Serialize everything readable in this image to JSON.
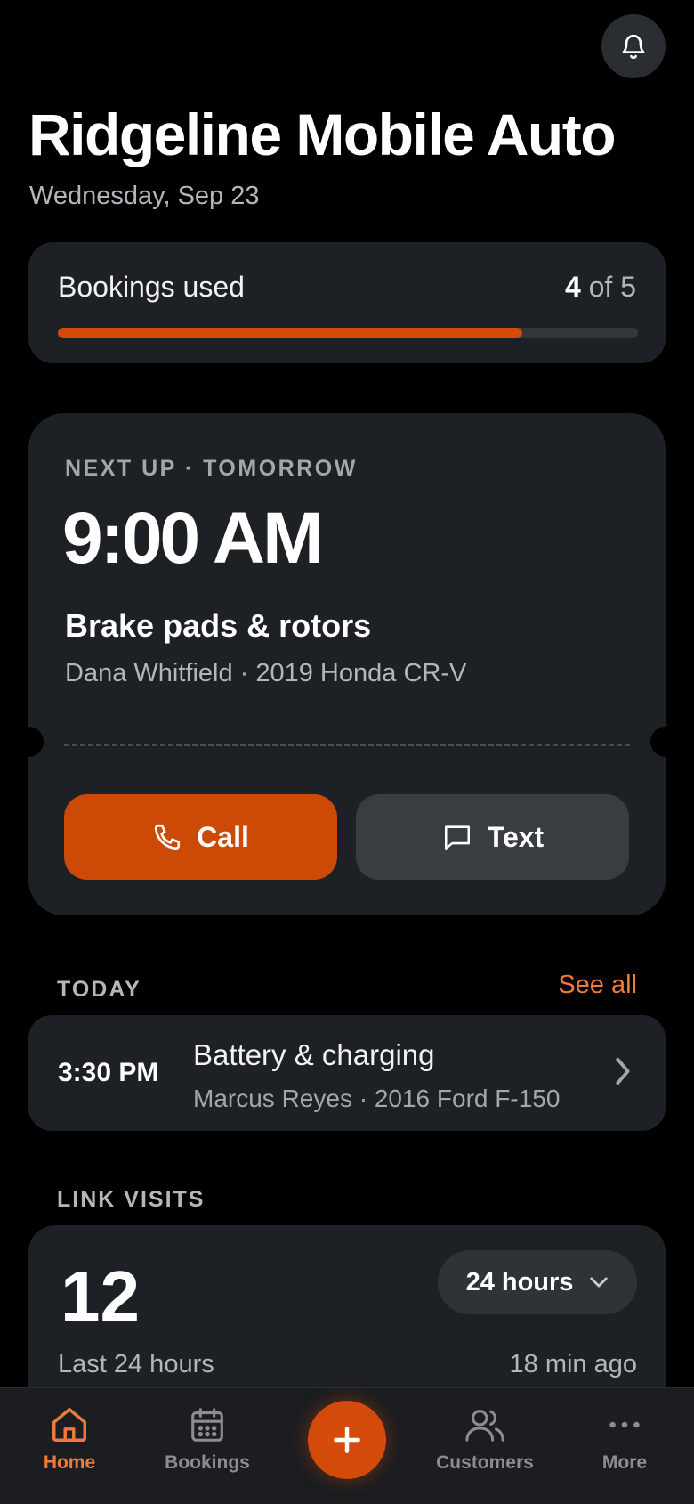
{
  "header": {
    "title": "Ridgeline Mobile Auto",
    "date": "Wednesday, Sep 23"
  },
  "usage": {
    "label": "Bookings used",
    "used": "4",
    "of_total": "of 5",
    "fill_fraction": 0.8
  },
  "next_up": {
    "label": "NEXT UP · TOMORROW",
    "time": "9:00 AM",
    "service": "Brake pads & rotors",
    "customer": "Dana Whitfield · 2019 Honda CR-V",
    "call_label": "Call",
    "text_label": "Text"
  },
  "today": {
    "label": "TODAY",
    "see_all": "See all",
    "items": [
      {
        "time": "3:30 PM",
        "service": "Battery & charging",
        "customer": "Marcus Reyes · 2016 Ford F-150"
      }
    ]
  },
  "link_visits": {
    "label": "LINK VISITS",
    "count": "12",
    "range_selected": "24 hours",
    "subtitle": "Last 24 hours",
    "updated": "18 min ago"
  },
  "nav": {
    "items": [
      {
        "label": "Home",
        "icon": "home-icon",
        "active": true
      },
      {
        "label": "Bookings",
        "icon": "calendar-icon",
        "active": false
      },
      {
        "label": "Customers",
        "icon": "users-icon",
        "active": false
      },
      {
        "label": "More",
        "icon": "more-icon",
        "active": false
      }
    ],
    "fab_icon": "plus-icon"
  },
  "colors": {
    "accent": "#d44a0a",
    "accent_text": "#f07a3c",
    "card": "#1d2024",
    "background": "#000000"
  }
}
